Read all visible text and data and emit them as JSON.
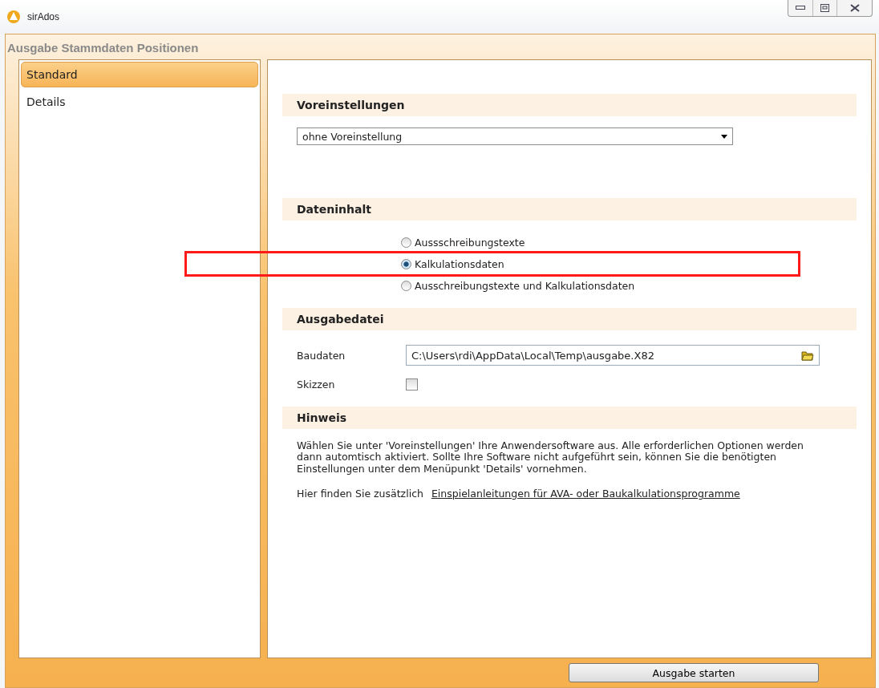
{
  "window": {
    "title": "sirAdos"
  },
  "dialog": {
    "title": "Ausgabe Stammdaten Positionen"
  },
  "sidebar": {
    "items": [
      {
        "label": "Standard",
        "selected": true
      },
      {
        "label": "Details",
        "selected": false
      }
    ]
  },
  "sections": [
    {
      "kind": "dropdown",
      "title": "Voreinstellungen",
      "value": "ohne Voreinstellung"
    },
    {
      "kind": "radios",
      "title": "Dateninhalt",
      "options": [
        {
          "label": "Aussschreibungstexte",
          "selected": false
        },
        {
          "label": "Kalkulationsdaten",
          "selected": true
        },
        {
          "label": "Ausschreibungstexte und Kalkulationsdaten",
          "selected": false
        }
      ]
    },
    {
      "kind": "file",
      "title": "Ausgabedatei",
      "path_label": "Baudaten",
      "path": "C:\\Users\\rdi\\AppData\\Local\\Temp\\ausgabe.X82",
      "check_label": "Skizzen",
      "checked": false
    },
    {
      "kind": "note",
      "title": "Hinweis",
      "text": "Wählen Sie unter 'Voreinstellungen' Ihre Anwendersoftware aus. Alle erforderlichen Optionen werden dann automtisch aktiviert. Sollte Ihre Software nicht aufgeführt sein, können Sie die benötigten Einstellungen unter dem Menüpunkt 'Details' vornehmen.",
      "link_prefix": "Hier finden Sie zusätzlich",
      "link": "Einspielanleitungen für AVA- oder Baukalkulationsprogramme"
    }
  ],
  "start_button": "Ausgabe starten"
}
